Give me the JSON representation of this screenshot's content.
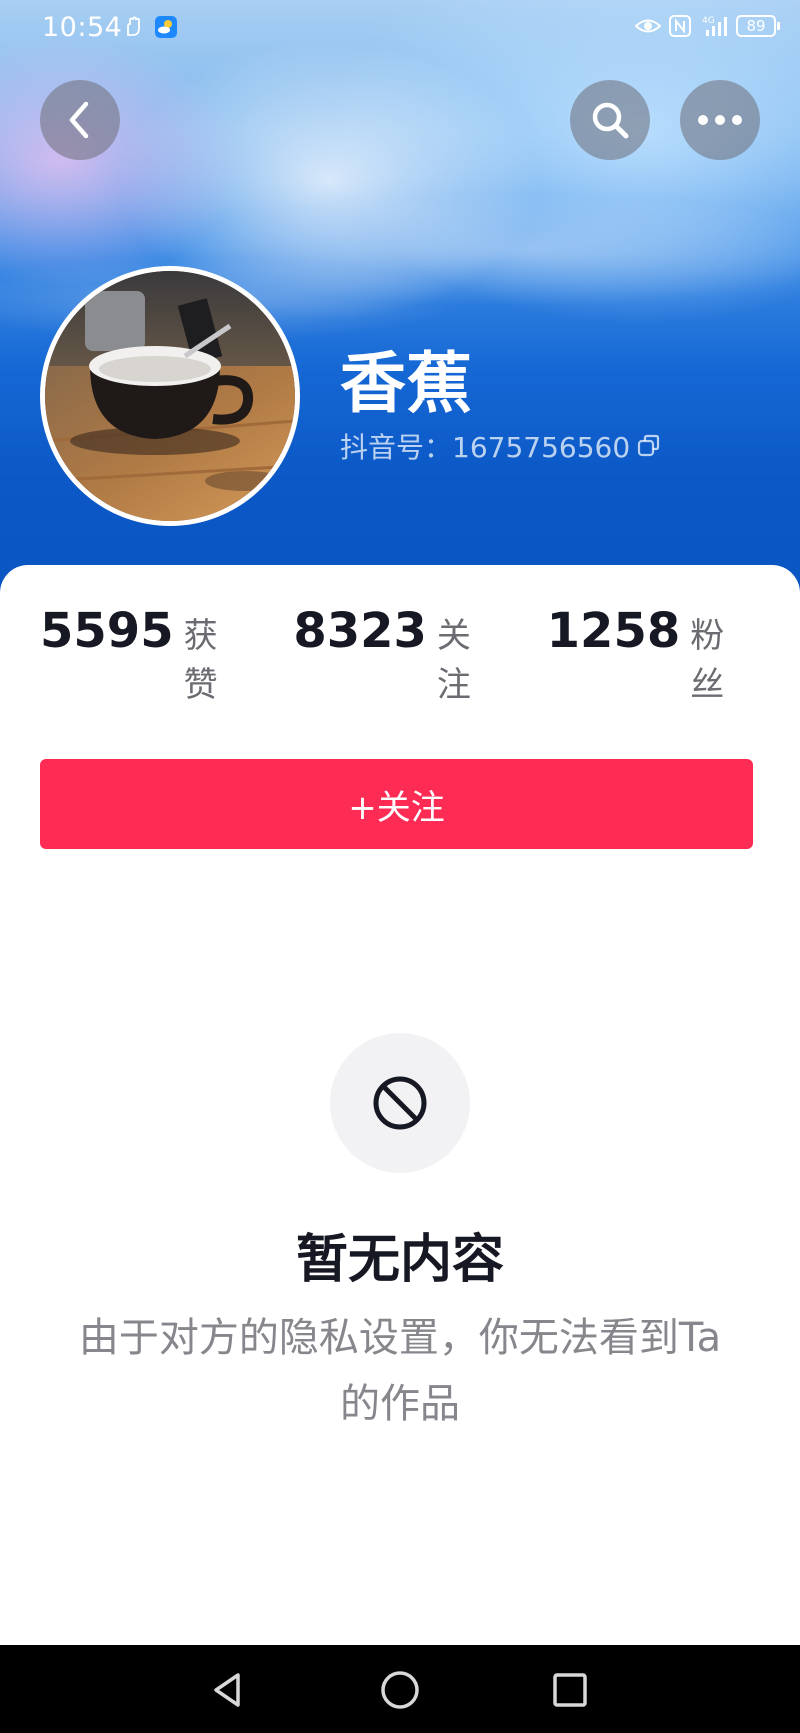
{
  "status_bar": {
    "time": "10:54",
    "battery": "89",
    "icons_left": [
      "hand-icon",
      "weather-icon"
    ],
    "icons_right": [
      "eye-icon",
      "nfc-icon",
      "signal-4g-icon",
      "battery-icon"
    ]
  },
  "header": {
    "back_icon": "chevron-left-icon",
    "search_icon": "search-icon",
    "more_icon": "more-dots-icon"
  },
  "profile": {
    "name": "香蕉",
    "douyin_id": "抖音号：1675756560",
    "copy_icon": "copy-icon",
    "avatar": "coffee-cup-photo"
  },
  "stats": [
    {
      "value": "5595",
      "label": "获赞"
    },
    {
      "value": "8323",
      "label": "关注"
    },
    {
      "value": "1258",
      "label": "粉丝"
    }
  ],
  "follow_button": {
    "label": "+关注",
    "color": "#fe2c55"
  },
  "empty_state": {
    "icon": "block-icon",
    "title": "暂无内容",
    "description": "由于对方的隐私设置，你无法看到Ta的作品"
  },
  "nav": {
    "back": "nav-back-icon",
    "home": "nav-home-icon",
    "recent": "nav-recent-icon"
  }
}
